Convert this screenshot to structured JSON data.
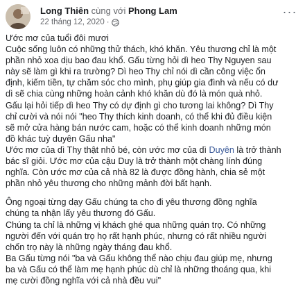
{
  "header": {
    "author": "Long Thiên",
    "with_text": "cùng với",
    "tagged": "Phong Lam",
    "date": "22 tháng 12, 2020",
    "separator": "·",
    "more_label": "···"
  },
  "icons": {
    "avatar": "avatar-image",
    "privacy": "globe-icon",
    "more": "more-options-icon"
  },
  "paragraph1": {
    "l1": "Ước mơ của tuổi đôi mươi",
    "l2": "Cuộc sống luôn có những thử thách, khó khăn. Yêu thương chỉ là một",
    "l3": "phần nhỏ xoa dịu bao đau khổ. Gấu từng hỏi dì heo Thy Nguyen sau",
    "l4": "này sẽ làm gì khi ra trường? Dì heo Thy chỉ nói dì cần công việc ổn",
    "l5": "định, kiếm tiền, tự chăm sóc cho mình, phụ giúp gia đình và nếu có dư",
    "l6": "dì sẽ chia cùng những hoàn cảnh khó khăn dù đó là món quà nhỏ.",
    "l7": "Gấu lại hỏi tiếp dì heo Thy có dự định gì cho tương lai không? Dì Thy",
    "l8": "chỉ cười và nói nói \"heo Thy thích kinh doanh, có thể khi đủ điều kiện",
    "l9": "sẽ mở cửa hàng bán nước cam, hoặc có thể kinh doanh những món",
    "l10": "đồ khác tuỳ duyên Gấu nha\"",
    "l11_a": "Ước mơ của dì Thy thật nhỏ bé, còn ước mơ của dì ",
    "l11_mention": "Duyên",
    "l11_b": " là trở thành",
    "l12": "bác sĩ giỏi. Ước mơ của cậu Duy là trở thành một chàng lính đúng",
    "l13": "nghĩa. Còn ước mơ của cả nhà 82 là được đồng hành, chia sẻ một",
    "l14": "phần nhỏ yêu thương cho những mảnh đời bất hạnh."
  },
  "paragraph2": {
    "l1": "Ông ngoại từng dạy Gấu chúng ta cho đi yêu thương đồng nghĩa",
    "l2": "chúng ta nhận lấy yêu thương đó Gấu.",
    "l3": "Chúng ta chỉ là những vị khách ghé qua những quán trọ. Có những",
    "l4": "người đến với quán trọ họ rất hạnh phúc, nhưng có rất nhiều người",
    "l5": "chốn trọ này là những ngày tháng đau khổ.",
    "l6": "Ba Gấu từng nói \"ba và Gấu không thể nào chịu đau giúp mẹ, nhưng",
    "l7": "ba và Gấu có thể làm mẹ hạnh phúc dù chỉ là những thoáng qua, khi",
    "l8": "mẹ cười đồng nghĩa với cả nhà đều vui\""
  }
}
